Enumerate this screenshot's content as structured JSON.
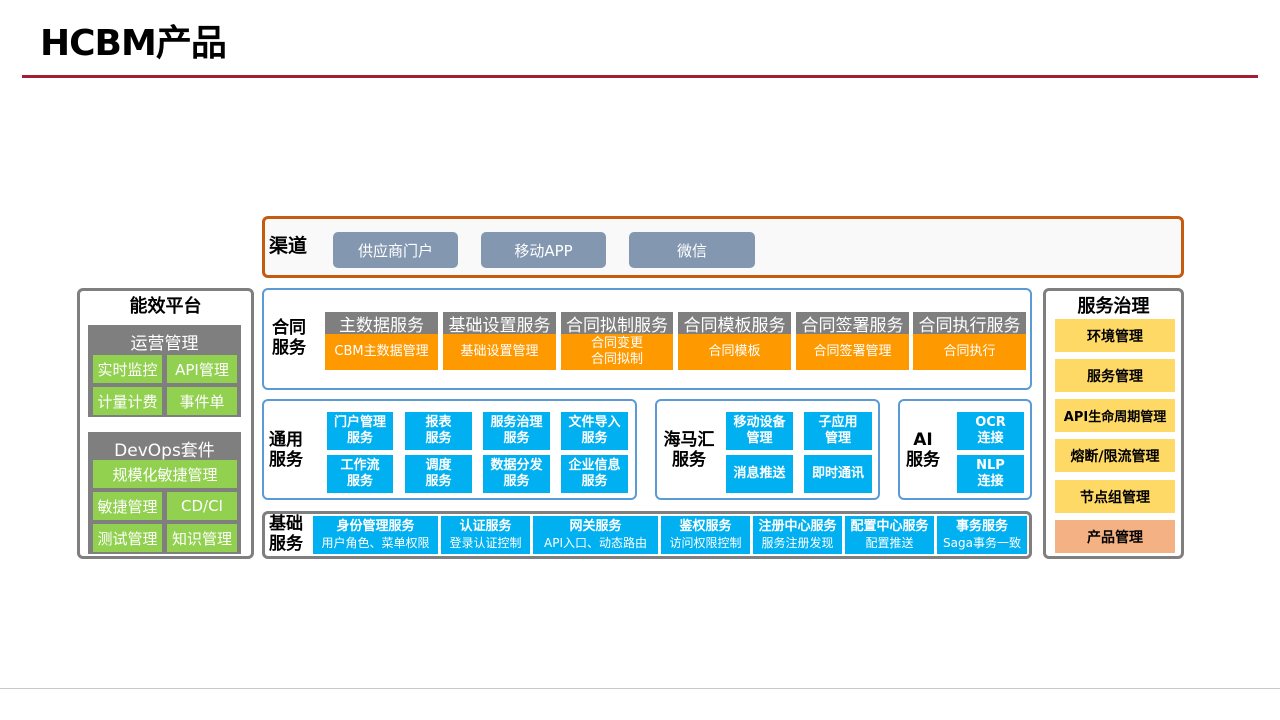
{
  "page": {
    "title": "HCBM产品"
  },
  "channel": {
    "label": "渠道",
    "items": [
      "供应商门户",
      "移动APP",
      "微信"
    ]
  },
  "efficiency": {
    "title": "能效平台",
    "ops": {
      "title": "运营管理",
      "items": [
        "实时监控",
        "API管理",
        "计量计费",
        "事件单"
      ]
    },
    "devops": {
      "title": "DevOps套件",
      "wide": "规模化敏捷管理",
      "items": [
        "敏捷管理",
        "CD/CI",
        "测试管理",
        "知识管理"
      ]
    }
  },
  "contract": {
    "label_line1": "合同",
    "label_line2": "服务",
    "columns": [
      {
        "header": "主数据服务",
        "body_line1": "CBM主数据管理",
        "body_line2": ""
      },
      {
        "header": "基础设置服务",
        "body_line1": "基础设置管理",
        "body_line2": ""
      },
      {
        "header": "合同拟制服务",
        "body_line1": "合同变更",
        "body_line2": "合同拟制"
      },
      {
        "header": "合同模板服务",
        "body_line1": "合同模板",
        "body_line2": ""
      },
      {
        "header": "合同签署服务",
        "body_line1": "合同签署管理",
        "body_line2": ""
      },
      {
        "header": "合同执行服务",
        "body_line1": "合同执行",
        "body_line2": ""
      }
    ]
  },
  "common": {
    "label_line1": "通用",
    "label_line2": "服务",
    "items": [
      {
        "l1": "门户管理",
        "l2": "服务"
      },
      {
        "l1": "报表",
        "l2": "服务"
      },
      {
        "l1": "服务治理",
        "l2": "服务"
      },
      {
        "l1": "文件导入",
        "l2": "服务"
      },
      {
        "l1": "工作流",
        "l2": "服务"
      },
      {
        "l1": "调度",
        "l2": "服务"
      },
      {
        "l1": "数据分发",
        "l2": "服务"
      },
      {
        "l1": "企业信息",
        "l2": "服务"
      }
    ]
  },
  "haimahui": {
    "label_line1": "海马汇",
    "label_line2": "服务",
    "items": [
      {
        "l1": "移动设备",
        "l2": "管理"
      },
      {
        "l1": "子应用",
        "l2": "管理"
      },
      {
        "l1": "消息推送",
        "l2": ""
      },
      {
        "l1": "即时通讯",
        "l2": ""
      }
    ]
  },
  "ai": {
    "label_line1": "AI",
    "label_line2": "服务",
    "items": [
      {
        "l1": "OCR",
        "l2": "连接"
      },
      {
        "l1": "NLP",
        "l2": "连接"
      }
    ]
  },
  "base": {
    "label_line1": "基础",
    "label_line2": "服务",
    "items": [
      {
        "title": "身份管理服务",
        "sub": "用户角色、菜单权限"
      },
      {
        "title": "认证服务",
        "sub": "登录认证控制"
      },
      {
        "title": "网关服务",
        "sub": "API入口、动态路由"
      },
      {
        "title": "鉴权服务",
        "sub": "访问权限控制"
      },
      {
        "title": "注册中心服务",
        "sub": "服务注册发现"
      },
      {
        "title": "配置中心服务",
        "sub": "配置推送"
      },
      {
        "title": "事务服务",
        "sub": "Saga事务一致"
      }
    ]
  },
  "governance": {
    "title": "服务治理",
    "items": [
      "环境管理",
      "服务管理",
      "API生命周期管理",
      "熔断/限流管理",
      "节点组管理",
      "产品管理"
    ]
  },
  "colors": {
    "title_rule": "#a51c30",
    "orange_accent": "#ff9900",
    "blue_accent": "#00b0f0",
    "green_accent": "#92d050",
    "yellow_accent": "#ffd966"
  }
}
